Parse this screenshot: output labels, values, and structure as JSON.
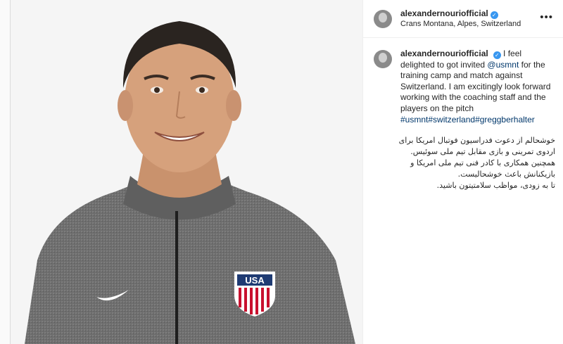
{
  "post": {
    "username": "alexandernouriofficial",
    "location": "Crans Montana, Alpes, Switzerland",
    "verified_icon": "verified-badge-icon",
    "more_icon": "more-options-icon"
  },
  "caption": {
    "username": "alexandernouriofficial",
    "part1": " I feel delighted to got invited ",
    "mention": "@usmnt",
    "part2": " for the training camp and match against Switzerland. I am excitingly look forward working with the coaching staff and the players on the pitch ",
    "hashtags": [
      "#usmnt",
      "#switzerland",
      "#greggberhalter"
    ],
    "persian_lines": [
      "خوشحالم از دعوت فدراسیون فوتبال امریکا برای",
      "اردوی تمرینی و بازی مقابل تیم ملی سوئیس.",
      "همچنین همکاری با کادر فنی تیم ملی امریکا و",
      "بازیکنانش باعث خوشحالیست.",
      "تا به زودی، مواظب سلامتیتون باشید."
    ]
  },
  "colors": {
    "link": "#00376b",
    "verified": "#3897f0",
    "jacket": "#6b6b6b"
  }
}
